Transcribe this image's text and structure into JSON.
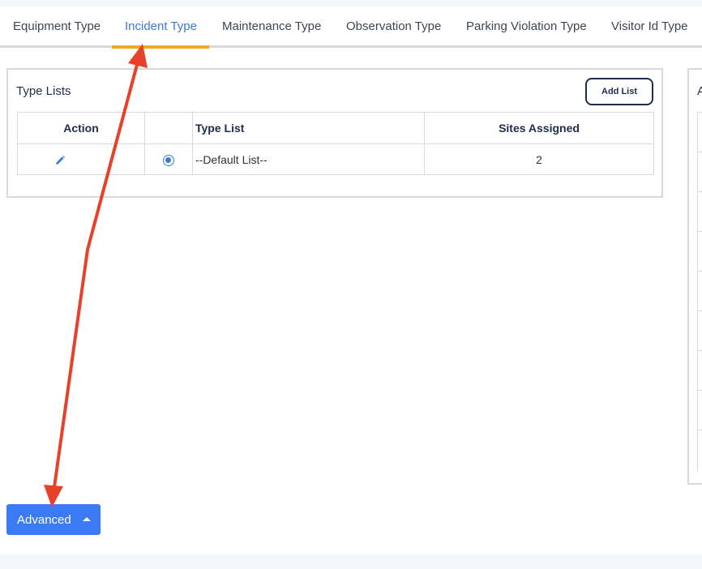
{
  "tabs": [
    {
      "label": "Equipment Type"
    },
    {
      "label": "Incident Type"
    },
    {
      "label": "Maintenance Type"
    },
    {
      "label": "Observation Type"
    },
    {
      "label": "Parking Violation Type"
    },
    {
      "label": "Visitor Id Type"
    }
  ],
  "active_tab": "Incident Type",
  "type_lists": {
    "title": "Type Lists",
    "add_button": "Add List",
    "columns": {
      "action": "Action",
      "radio": "",
      "type_list": "Type List",
      "sites": "Sites Assigned"
    },
    "rows": [
      {
        "type_list": "--Default List--",
        "sites_assigned": "2",
        "selected": true
      }
    ]
  },
  "side_panel": {
    "title_fragment": "A"
  },
  "advanced_button": {
    "label": "Advanced"
  },
  "icons": {
    "edit": "pencil-icon",
    "radio": "radio-selected-icon",
    "caret": "caret-up-icon"
  },
  "colors": {
    "accent": "#3a7bd5",
    "tab_indicator": "#f5a623",
    "primary_button": "#3a7bf5",
    "annotation_arrow": "#e8412a"
  }
}
